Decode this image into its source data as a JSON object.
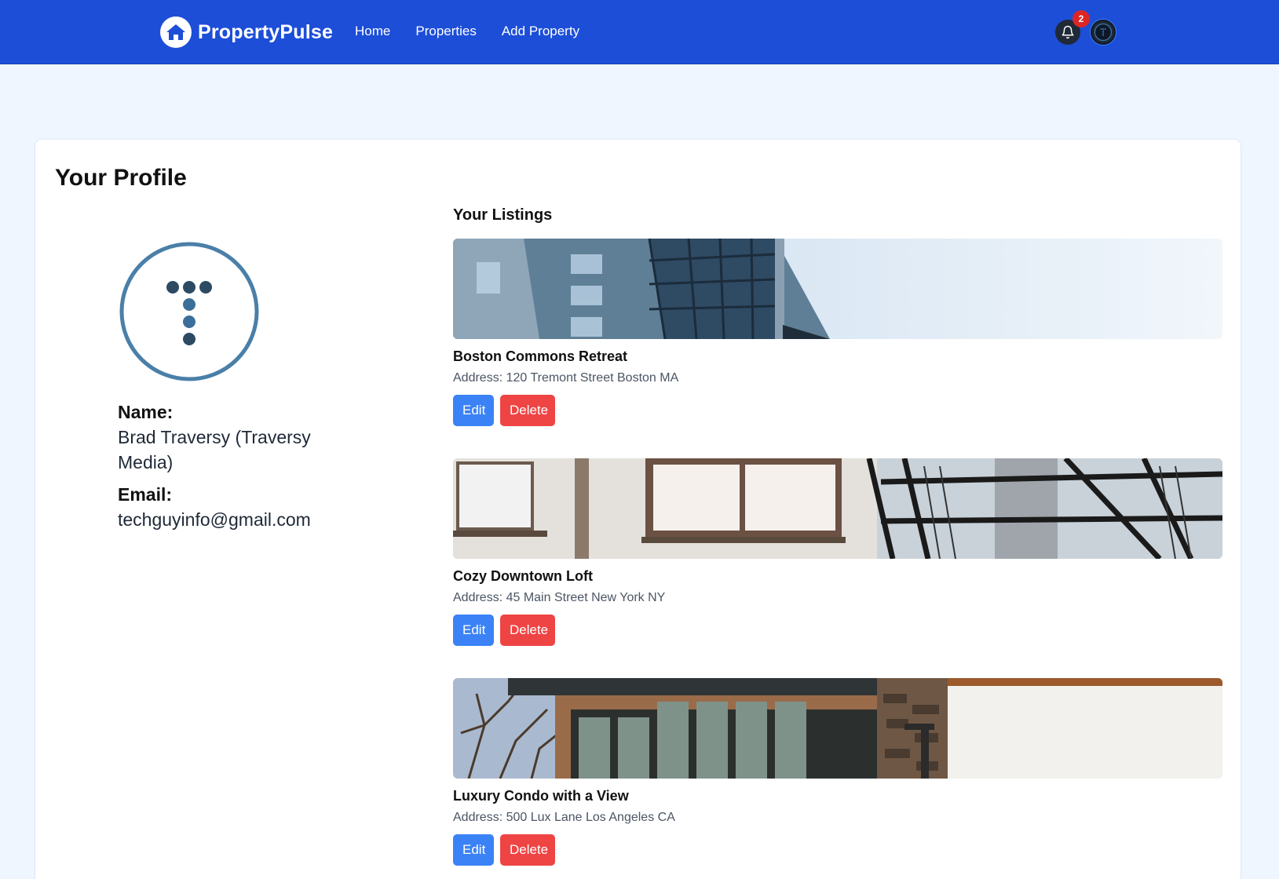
{
  "nav": {
    "brand": "PropertyPulse",
    "links": [
      "Home",
      "Properties",
      "Add Property"
    ],
    "notification_count": "2",
    "icons": {
      "logo": "house-icon",
      "bell": "bell-icon",
      "avatar": "user-avatar"
    }
  },
  "profile": {
    "page_title": "Your Profile",
    "name_label": "Name:",
    "name_value": "Brad Traversy (Traversy Media)",
    "email_label": "Email:",
    "email_value": "techguyinfo@gmail.com"
  },
  "listings": {
    "title": "Your Listings",
    "items": [
      {
        "name": "Boston Commons Retreat",
        "address": "Address: 120 Tremont Street Boston MA",
        "edit_label": "Edit",
        "delete_label": "Delete"
      },
      {
        "name": "Cozy Downtown Loft",
        "address": "Address: 45 Main Street New York NY",
        "edit_label": "Edit",
        "delete_label": "Delete"
      },
      {
        "name": "Luxury Condo with a View",
        "address": "Address: 500 Lux Lane Los Angeles CA",
        "edit_label": "Edit",
        "delete_label": "Delete"
      }
    ]
  },
  "colors": {
    "navbar": "#1d4ed8",
    "page_bg": "#eff6ff",
    "edit_button": "#3b82f6",
    "delete_button": "#ef4444",
    "badge": "#dc2626"
  }
}
